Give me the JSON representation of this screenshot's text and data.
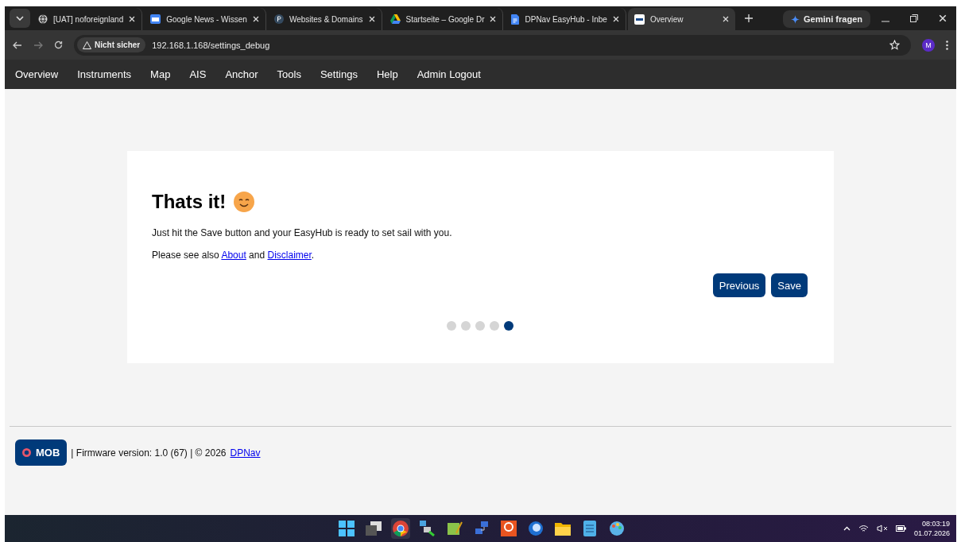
{
  "browser": {
    "tabs": [
      {
        "title": "[UAT] noforeignland",
        "kind": "globe",
        "selected": false
      },
      {
        "title": "Google News - Wissen",
        "kind": "news",
        "selected": false
      },
      {
        "title": "Websites & Domains",
        "kind": "p",
        "selected": false
      },
      {
        "title": "Startseite – Google Dr",
        "kind": "drive",
        "selected": false
      },
      {
        "title": "DPNav EasyHub - Inbe",
        "kind": "doc",
        "selected": false
      },
      {
        "title": "Overview",
        "kind": "site",
        "selected": true
      }
    ],
    "gemini": "Gemini fragen",
    "security": "Nicht sicher",
    "url": "192.168.1.168/settings_debug",
    "profile": "M"
  },
  "nav": [
    "Overview",
    "Instruments",
    "Map",
    "AIS",
    "Anchor",
    "Tools",
    "Settings",
    "Help",
    "Admin Logout"
  ],
  "card": {
    "title": "Thats it!",
    "line1": "Just hit the Save button and your EasyHub is ready to set sail with you.",
    "line2_before": "Please see also",
    "link1": "About",
    "line2_mid": "and",
    "link2": "Disclaimer",
    "line2_after": ".",
    "buttons": [
      "Previous",
      "Save"
    ],
    "steps": [
      {
        "selected": false
      },
      {
        "selected": false
      },
      {
        "selected": false
      },
      {
        "selected": false
      },
      {
        "selected": true
      }
    ]
  },
  "footer": {
    "mob": "MOB",
    "text": "| Firmware version: 1.0 (67) | © 2026",
    "link": "DPNav"
  },
  "taskbar": {
    "time": "08:03:19",
    "date": "01.07.2026"
  }
}
